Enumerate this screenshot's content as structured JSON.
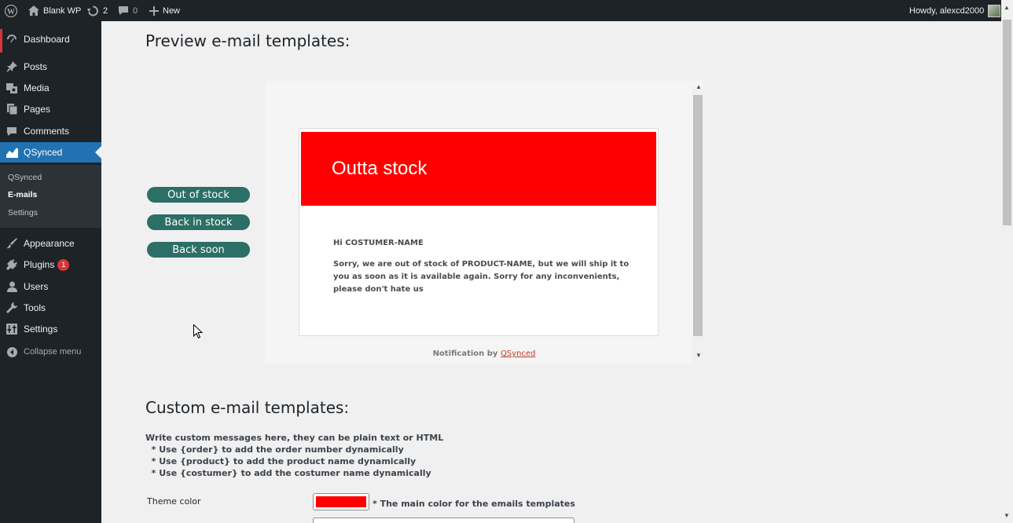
{
  "adminbar": {
    "site_name": "Blank WP",
    "updates_count": "2",
    "comments_count": "0",
    "new_label": "New",
    "greeting": "Howdy, alexcd2000"
  },
  "sidebar": {
    "items": [
      {
        "label": "Dashboard",
        "icon": "dashboard-icon"
      },
      {
        "label": "Posts",
        "icon": "pin-icon"
      },
      {
        "label": "Media",
        "icon": "media-icon"
      },
      {
        "label": "Pages",
        "icon": "pages-icon"
      },
      {
        "label": "Comments",
        "icon": "comment-icon"
      },
      {
        "label": "QSynced",
        "icon": "chart-icon"
      },
      {
        "label": "Appearance",
        "icon": "brush-icon"
      },
      {
        "label": "Plugins",
        "icon": "plug-icon",
        "badge": "1"
      },
      {
        "label": "Users",
        "icon": "user-icon"
      },
      {
        "label": "Tools",
        "icon": "wrench-icon"
      },
      {
        "label": "Settings",
        "icon": "settings-icon"
      }
    ],
    "submenu": [
      "QSynced",
      "E-mails",
      "Settings"
    ],
    "collapse_label": "Collapse menu"
  },
  "preview": {
    "heading": "Preview e-mail templates:",
    "buttons": [
      "Out of stock",
      "Back in stock",
      "Back soon"
    ],
    "email_title": "Outta stock",
    "email_greeting": "Hi COSTUMER-NAME",
    "email_message": "Sorry, we are out of stock of PRODUCT-NAME, but we will ship it to you as soon as it is available again. Sorry for any inconvenients, please don't hate us",
    "footer_prefix": "Notification by ",
    "footer_link": "QSynced",
    "accent_color": "#ff0000"
  },
  "custom": {
    "heading": "Custom e-mail templates:",
    "description": [
      "Write custom messages here, they can be plain text or HTML",
      "  * Use {order} to add the order number dynamically",
      "  * Use {product} to add the product name dynamically",
      "  * Use {costumer} to add the costumer name dynamically"
    ],
    "theme_label": "Theme color",
    "theme_color": "#ff0000",
    "theme_help": "* The main color for the emails templates"
  }
}
